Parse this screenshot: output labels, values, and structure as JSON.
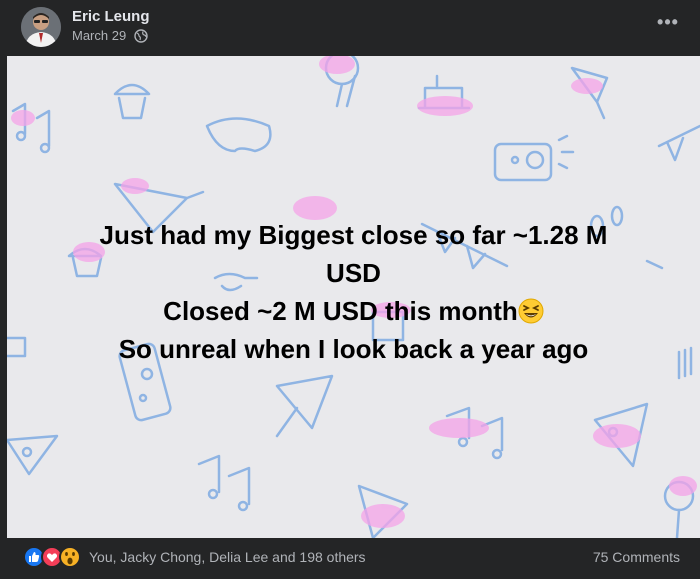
{
  "post": {
    "author_name": "Eric Leung",
    "date": "March 29",
    "audience_icon": "globe-icon",
    "more_icon": "more-options-icon",
    "more_label": "•••"
  },
  "image_text": {
    "line1": "Just had my Biggest close so far ~1.28 M",
    "line2": "USD",
    "line3": "Closed ~2 M USD this month",
    "line3_emoji": "grinning-squinting-face-emoji",
    "line4": "So unreal when I look back a year ago"
  },
  "footer": {
    "reaction_icons": [
      "like-icon",
      "love-icon",
      "wow-icon"
    ],
    "reaction_summary": "You, Jacky Chong, Delia Lee and 198 others",
    "comment_count": "75 Comments"
  },
  "colors": {
    "background": "#242526",
    "image_background": "#e9e9ec",
    "pattern_blue": "#8fb4e3",
    "pattern_pink": "#f4a3e8",
    "like": "#1877f2",
    "love": "#f33e58",
    "wow": "#f7b125"
  }
}
